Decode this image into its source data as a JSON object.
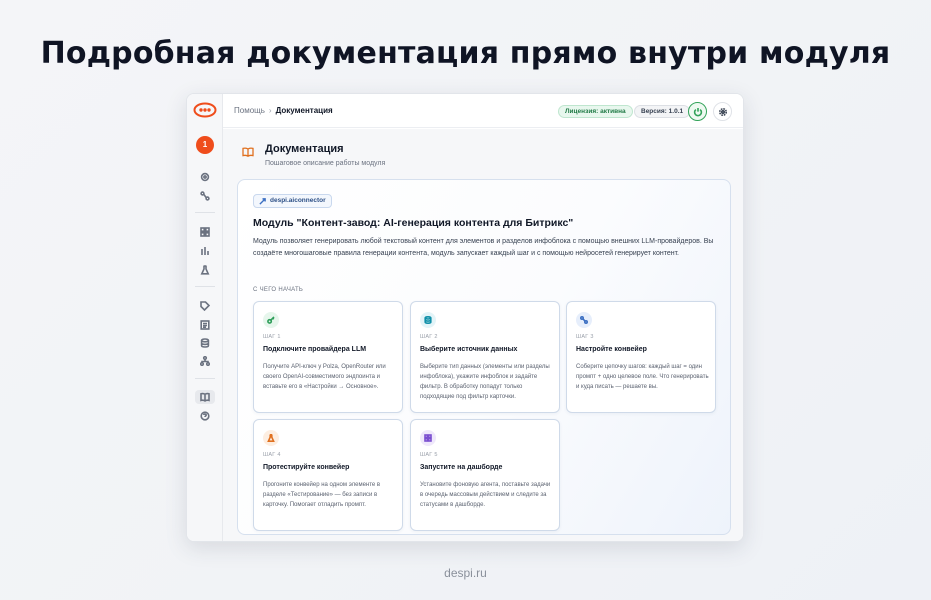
{
  "headline": "Подробная документация прямо внутри модуля",
  "footer": "despi.ru",
  "colors": {
    "accent": "#ef4d1c",
    "success": "#33a35a",
    "panel_border": "#d6e0ee"
  },
  "sidebar": {
    "logo": "despi-logo",
    "avatar_badge": "1",
    "icons": [
      "gear-icon",
      "route-icon",
      "grid-icon",
      "bars-icon",
      "flask-icon",
      "tag-icon",
      "list-icon",
      "database-icon",
      "network-icon",
      "book-icon",
      "help-icon"
    ],
    "active": "book-icon"
  },
  "topbar": {
    "breadcrumb": [
      "Помощь",
      "Документация"
    ],
    "license_badge": "Лицензия: активна",
    "version_badge": "Версия: 1.0.1",
    "power_icon": "power-icon",
    "settings_icon": "gear-icon"
  },
  "page": {
    "icon": "book-open-icon",
    "title": "Документация",
    "subtitle": "Пошаговое описание работы модуля"
  },
  "module": {
    "chip": "despi.aiconnector",
    "title": "Модуль \"Контент-завод: AI-генерация контента для Битрикс\"",
    "description": "Модуль позволяет генерировать любой текстовый контент для элементов и разделов инфоблока с помощью внешних LLM-провайдеров. Вы создаёте многошаговые правила генерации контента, модуль запускает каждый шаг и с помощью нейросетей генерирует контент.",
    "section_label": "С ЧЕГО НАЧАТЬ"
  },
  "steps": [
    {
      "icon": "key-icon",
      "step": "ШАГ 1",
      "title": "Подключите провайдера LLM",
      "text": "Получите API-ключ у Polza, OpenRouter или своего OpenAI-совместимого эндпоинта и вставьте его в «Настройки → Основное».",
      "color": "#2f9e5a",
      "bg": "#e6f6ec"
    },
    {
      "icon": "database-icon",
      "step": "ШАГ 2",
      "title": "Выберите источник данных",
      "text": "Выберите тип данных (элементы или разделы инфоблока), укажите инфоблок и задайте фильтр. В обработку попадут только подходящие под фильтр карточки.",
      "color": "#0e8fa8",
      "bg": "#e3f4f8"
    },
    {
      "icon": "route-icon",
      "step": "ШАГ 3",
      "title": "Настройте конвейер",
      "text": "Соберите цепочку шагов: каждый шаг = один промпт + одно целевое поле. Что генерировать и куда писать — решаете вы.",
      "color": "#3b6fc2",
      "bg": "#e6eefb"
    },
    {
      "icon": "flask-icon",
      "step": "ШАГ 4",
      "title": "Протестируйте конвейер",
      "text": "Прогоните конвейер на одном элементе в разделе «Тестирование» — без записи в карточку. Помогает отладить промпт.",
      "color": "#e0701f",
      "bg": "#fdeee1"
    },
    {
      "icon": "grid-icon",
      "step": "ШАГ 5",
      "title": "Запустите на дашборде",
      "text": "Установите фоновую агента, поставьте задачи в очередь массовым действием и следите за статусами в дашборде.",
      "color": "#7b4fd0",
      "bg": "#efe8fb"
    }
  ]
}
